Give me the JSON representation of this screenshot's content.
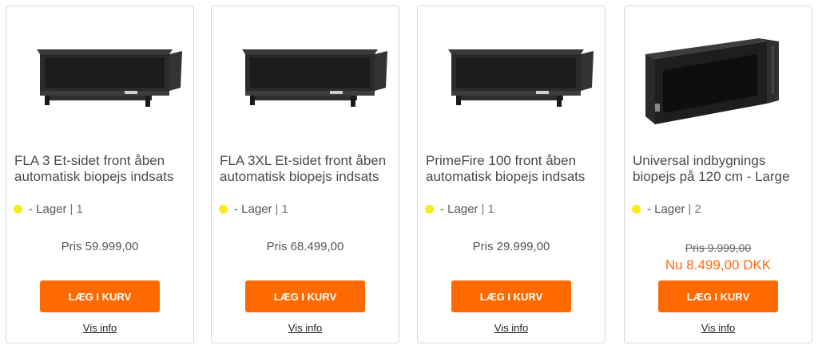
{
  "products": [
    {
      "title": "FLA 3 Et-sidet front åben automatisk biopejs indsats",
      "stock_label": "- Lager",
      "separator": "|",
      "stock_qty": "1",
      "price": "Pris 59.999,00",
      "button": "LÆG I KURV",
      "info": "Vis info"
    },
    {
      "title": "FLA 3XL Et-sidet front åben automatisk biopejs indsats",
      "stock_label": "- Lager",
      "separator": "|",
      "stock_qty": "1",
      "price": "Pris 68.499,00",
      "button": "LÆG I KURV",
      "info": "Vis info"
    },
    {
      "title": "PrimeFire 100 front åben automatisk biopejs indsats",
      "stock_label": "- Lager",
      "separator": "|",
      "stock_qty": "1",
      "price": "Pris 29.999,00",
      "button": "LÆG I KURV",
      "info": "Vis info"
    },
    {
      "title": "Universal indbygnings biopejs på 120 cm - Large",
      "stock_label": "- Lager",
      "separator": "|",
      "stock_qty": "2",
      "old_price": "Pris 9.999,00",
      "now_price": "Nu 8.499,00 DKK",
      "button": "LÆG I KURV",
      "info": "Vis info"
    }
  ],
  "colors": {
    "accent": "#ff6a00",
    "sale": "#ff6a13",
    "stock_dot": "#f7ec1a"
  }
}
